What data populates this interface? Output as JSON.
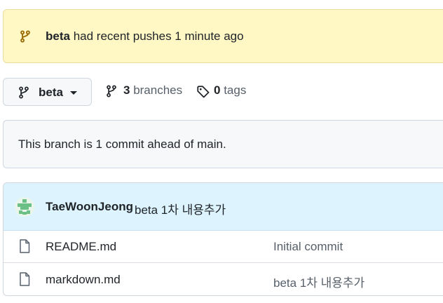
{
  "banner": {
    "branch_name": "beta",
    "message": " had recent pushes 1 minute ago"
  },
  "branch_selector": {
    "label": "beta"
  },
  "branches_link": {
    "count": "3",
    "label": " branches"
  },
  "tags_link": {
    "count": "0",
    "label": " tags"
  },
  "ahead_notice": {
    "text": "This branch is 1 commit ahead of main."
  },
  "latest_commit": {
    "author": "TaeWoonJeong",
    "message": "beta 1차 내용추가"
  },
  "files": [
    {
      "name": "README.md",
      "commit_message": "Initial commit"
    },
    {
      "name": "markdown.md",
      "commit_message": "beta 1차 내용추가"
    }
  ],
  "icons": {
    "banner": "git-branch-icon",
    "branch_selector": "git-branch-icon",
    "branches": "git-branch-icon",
    "tags": "tag-icon",
    "file": "file-icon"
  },
  "colors": {
    "banner_bg": "#fff8c5",
    "banner_icon": "#9a6700",
    "commit_row_bg": "#ddf4ff",
    "muted_text": "#57606a"
  }
}
